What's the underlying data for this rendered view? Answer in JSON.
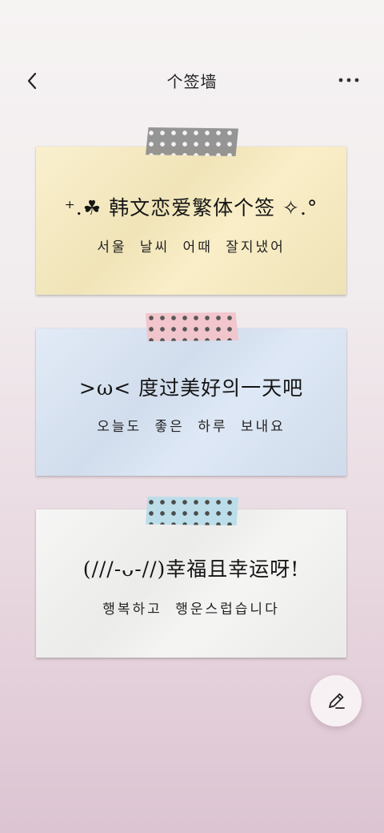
{
  "header": {
    "title": "个签墙",
    "back_icon": "chevron-left-icon",
    "more_icon": "more-dots-icon"
  },
  "cards": [
    {
      "title": "⁺.☘ 韩文恋爱繁体个签 ✧.°",
      "subtitle": "서울 날씨 어때 잘지냈어",
      "bg_color": "#f8ebbe",
      "tape_color": "#8e8e8e"
    },
    {
      "title": ">ω< 度过美好의一天吧",
      "subtitle": "오늘도 좋은 하루 보내요",
      "bg_color": "#d8e4f4",
      "tape_color": "#f2c3c9"
    },
    {
      "title": "(///-ᴗ-//)幸福且幸运呀!",
      "subtitle": "행복하고 행운스럽습니다",
      "bg_color": "#f3f3f2",
      "tape_color": "#b7ddea"
    }
  ],
  "fab": {
    "icon": "pencil-icon"
  }
}
